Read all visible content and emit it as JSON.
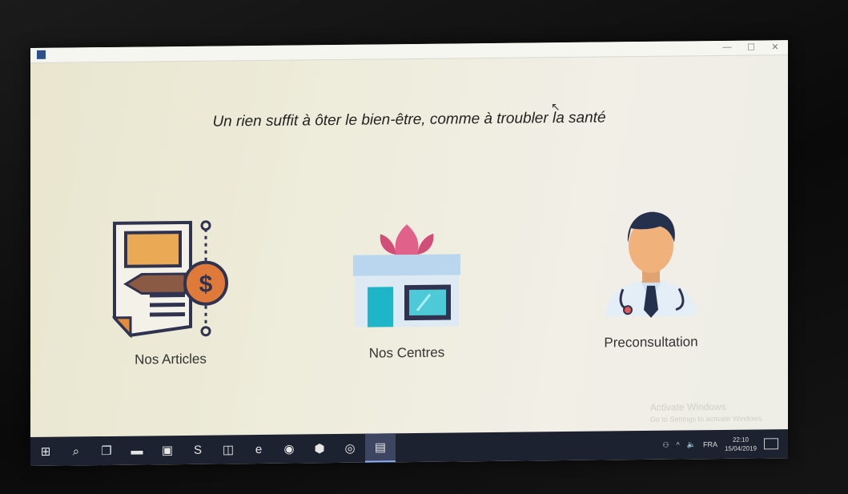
{
  "window": {
    "controls": [
      "—",
      "☐",
      "✕"
    ]
  },
  "main": {
    "tagline": "Un rien suffit à ôter le bien-être, comme à troubler la santé",
    "features": [
      {
        "label": "Nos Articles",
        "icon": "article-dollar-icon"
      },
      {
        "label": "Nos Centres",
        "icon": "health-center-icon"
      },
      {
        "label": "Preconsultation",
        "icon": "doctor-icon"
      }
    ]
  },
  "watermark": {
    "line1": "Activate Windows",
    "line2": "Go to Settings to activate Windows."
  },
  "taskbar": {
    "items": [
      {
        "icon": "windows-start-icon",
        "glyph": "⊞"
      },
      {
        "icon": "search-icon",
        "glyph": "⌕"
      },
      {
        "icon": "task-view-icon",
        "glyph": "❐"
      },
      {
        "icon": "file-explorer-icon",
        "glyph": "▬"
      },
      {
        "icon": "store-icon",
        "glyph": "▣"
      },
      {
        "icon": "sublime-icon",
        "glyph": "S"
      },
      {
        "icon": "app-icon",
        "glyph": "◫"
      },
      {
        "icon": "edge-icon",
        "glyph": "e"
      },
      {
        "icon": "chrome-icon",
        "glyph": "◉"
      },
      {
        "icon": "virtualbox-icon",
        "glyph": "⬢"
      },
      {
        "icon": "ubuntu-icon",
        "glyph": "◎"
      },
      {
        "icon": "running-app-icon",
        "glyph": "▤"
      }
    ],
    "tray": {
      "lang": "FRA",
      "time": "22:10",
      "date": "15/04/2019"
    }
  }
}
